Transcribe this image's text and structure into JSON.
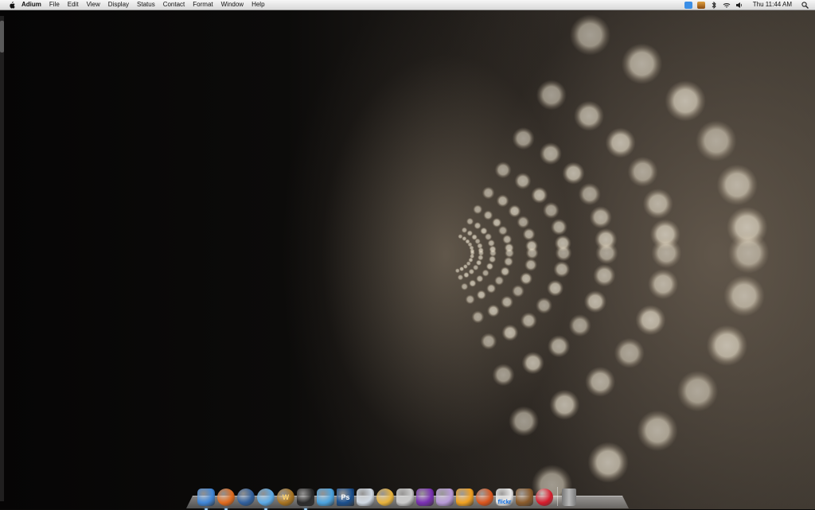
{
  "menubar": {
    "apple": "apple-icon",
    "app_name": "Adium",
    "items": [
      "File",
      "Edit",
      "View",
      "Display",
      "Status",
      "Contact",
      "Format",
      "Window",
      "Help"
    ],
    "status_icons": [
      "adium-status-icon",
      "growl-icon",
      "bluetooth-icon",
      "wifi-icon",
      "volume-icon"
    ],
    "clock": "Thu 11:44 AM",
    "spotlight": "spotlight-icon"
  },
  "dock": {
    "apps": [
      {
        "name": "Finder",
        "icon": "finder-icon",
        "color": "#3f86d8",
        "running": true
      },
      {
        "name": "Firefox",
        "icon": "firefox-icon",
        "color": "#e06a1c",
        "running": true
      },
      {
        "name": "Thunderbird",
        "icon": "thunderbird-icon",
        "color": "#2f5f9d",
        "running": false
      },
      {
        "name": "iTunes",
        "icon": "itunes-icon",
        "color": "#5aa9e6",
        "running": true
      },
      {
        "name": "World of Warcraft",
        "icon": "warcraft-icon",
        "color": "#a8731f",
        "running": false
      },
      {
        "name": "Adium",
        "icon": "adium-icon",
        "color": "#2b2b2b",
        "running": true
      },
      {
        "name": "Sidenote",
        "icon": "sidenote-icon",
        "color": "#4aa3e0",
        "running": false
      },
      {
        "name": "Photoshop",
        "icon": "photoshop-icon",
        "color": "#1a4f8e",
        "running": false
      },
      {
        "name": "Chat",
        "icon": "chat-icon",
        "color": "#cfd8e3",
        "running": false
      },
      {
        "name": "Globe",
        "icon": "globe-icon",
        "color": "#e8b23a",
        "running": false
      },
      {
        "name": "TextEdit",
        "icon": "pen-tool-icon",
        "color": "#c9c9c9",
        "running": false
      },
      {
        "name": "Frame",
        "icon": "frame-icon",
        "color": "#7a2fb3",
        "running": false
      },
      {
        "name": "Transmit",
        "icon": "truck-icon",
        "color": "#b89ad8",
        "running": false
      },
      {
        "name": "Cyberduck",
        "icon": "duck-icon",
        "color": "#f0a020",
        "running": false
      },
      {
        "name": "Burn",
        "icon": "flame-icon",
        "color": "#d9541c",
        "running": false
      },
      {
        "name": "Flickr Uploader",
        "icon": "flickr-icon",
        "color": "#e8e8e8",
        "running": false
      },
      {
        "name": "Photo Booth",
        "icon": "photo-booth-icon",
        "color": "#8a5a2a",
        "running": false
      },
      {
        "name": "Last.fm",
        "icon": "lastfm-icon",
        "color": "#d61b2b",
        "running": false
      }
    ],
    "trash": {
      "name": "Trash",
      "icon": "trash-icon",
      "color": "#b8b8b8"
    },
    "flickr_label": "flickr"
  }
}
